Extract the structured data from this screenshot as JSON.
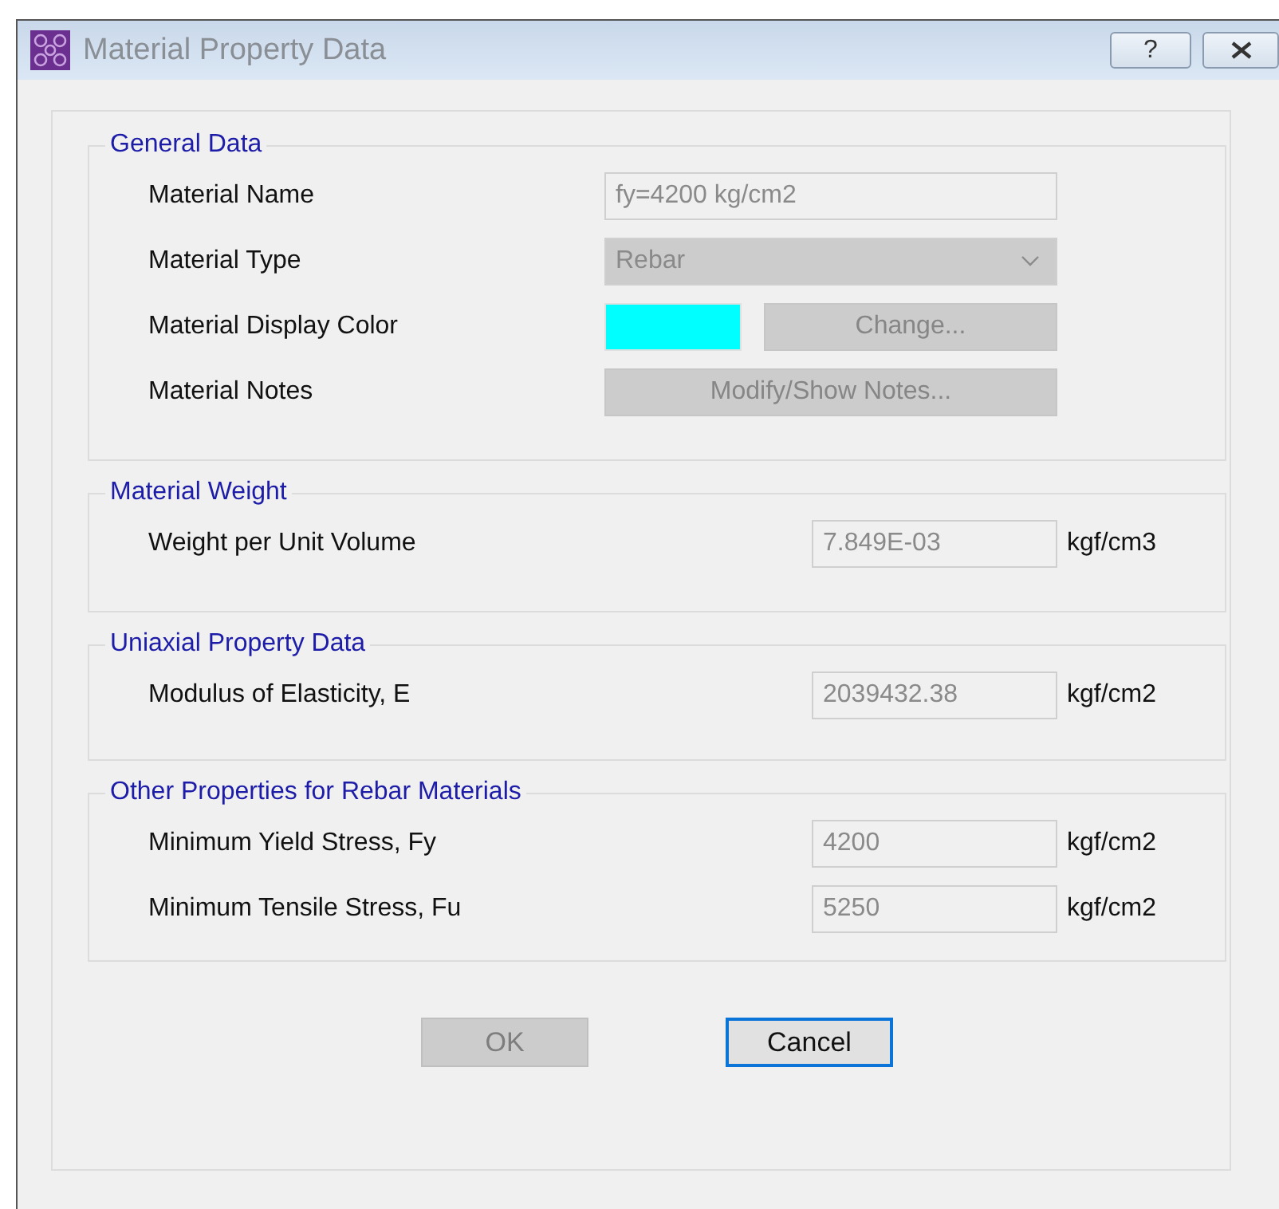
{
  "window": {
    "title": "Material Property Data",
    "help_button": "?"
  },
  "groups": [
    {
      "title": "General Data",
      "rows": [
        {
          "kind": "text",
          "label": "Material Name",
          "value": "fy=4200 kg/cm2",
          "disabled": true
        },
        {
          "kind": "dropdown",
          "label": "Material Type",
          "value": "Rebar",
          "disabled": true
        },
        {
          "kind": "color",
          "label": "Material Display Color",
          "color": "#00ffff",
          "button": "Change...",
          "disabled": true
        },
        {
          "kind": "button",
          "label": "Material Notes",
          "button": "Modify/Show Notes...",
          "disabled": true
        }
      ]
    },
    {
      "title": "Material Weight",
      "rows": [
        {
          "kind": "number",
          "label": "Weight per Unit Volume",
          "value": "7.849E-03",
          "unit": "kgf/cm3",
          "disabled": true
        }
      ]
    },
    {
      "title": "Uniaxial Property Data",
      "rows": [
        {
          "kind": "number",
          "label": "Modulus of Elasticity,  E",
          "value": "2039432.38",
          "unit": "kgf/cm2",
          "disabled": true
        }
      ]
    },
    {
      "title": "Other Properties for Rebar Materials",
      "rows": [
        {
          "kind": "number",
          "label": "Minimum Yield Stress, Fy",
          "value": "4200",
          "unit": "kgf/cm2",
          "disabled": true
        },
        {
          "kind": "number",
          "label": "Minimum Tensile Stress, Fu",
          "value": "5250",
          "unit": "kgf/cm2",
          "disabled": true
        }
      ]
    }
  ],
  "buttons": [
    {
      "label": "OK",
      "disabled": true,
      "default": false
    },
    {
      "label": "Cancel",
      "disabled": false,
      "default": true
    }
  ]
}
